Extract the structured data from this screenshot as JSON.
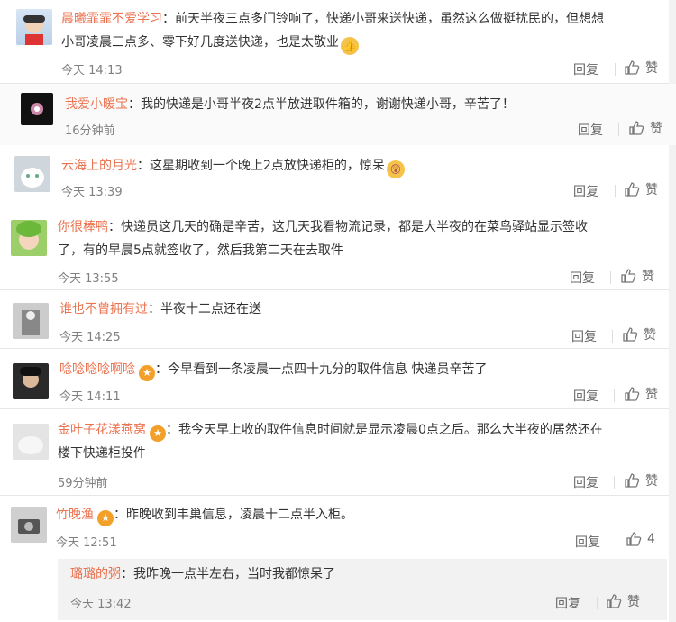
{
  "comments": [
    {
      "user": "晨曦霏霏不爱学习",
      "text_line1": "：前天半夜三点多门铃响了，快递小哥来送快递，虽然这么做挺扰民的，但想想",
      "text_line2": "小哥凌晨三点多、零下好几度送快递，也是太敬业",
      "emoji": "👍",
      "time": "今天 14:13",
      "reply": "回复",
      "like": "赞"
    },
    {
      "user": "我爱小暖宝",
      "text_line1": "：我的快递是小哥半夜2点半放进取件箱的，谢谢快递小哥，辛苦了！",
      "time": "16分钟前",
      "reply": "回复",
      "like": "赞"
    },
    {
      "user": "云海上的月光",
      "text_line1": "：这星期收到一个晚上2点放快递柜的，惊呆",
      "emoji": "😲",
      "time": "今天 13:39",
      "reply": "回复",
      "like": "赞"
    },
    {
      "user": "你很棒鸭",
      "text_line1": "：快递员这几天的确是辛苦，这几天我看物流记录，都是大半夜的在菜鸟驿站显示签收",
      "text_line2": "了，有的早晨5点就签收了，然后我第二天在去取件",
      "time": "今天 13:55",
      "reply": "回复",
      "like": "赞"
    },
    {
      "user": "谁也不曾拥有过",
      "text_line1": "：半夜十二点还在送",
      "time": "今天 14:25",
      "reply": "回复",
      "like": "赞"
    },
    {
      "user": "唸唸唸唸啊唸",
      "text_line1": "：今早看到一条凌晨一点四十九分的取件信息  快递员辛苦了",
      "time": "今天 14:11",
      "reply": "回复",
      "like": "赞"
    },
    {
      "user": "金叶子花漾燕窝",
      "text_line1": "：我今天早上收的取件信息时间就是显示凌晨0点之后。那么大半夜的居然还在",
      "text_line2": "楼下快递柜投件",
      "time": "59分钟前",
      "reply": "回复",
      "like": "赞"
    },
    {
      "user": "竹晚渔",
      "text_line1": "：昨晚收到丰巢信息，凌晨十二点半入柜。",
      "time": "今天 12:51",
      "reply": "回复",
      "like": "4"
    }
  ],
  "subreply": {
    "user": "璐璐的粥",
    "text": "：我昨晚一点半左右，当时我都惊呆了",
    "time": "今天 13:42",
    "reply": "回复",
    "like": "赞"
  },
  "colors": {
    "username": "#eb7350",
    "time": "#808080",
    "badge": "#f3a02b"
  }
}
